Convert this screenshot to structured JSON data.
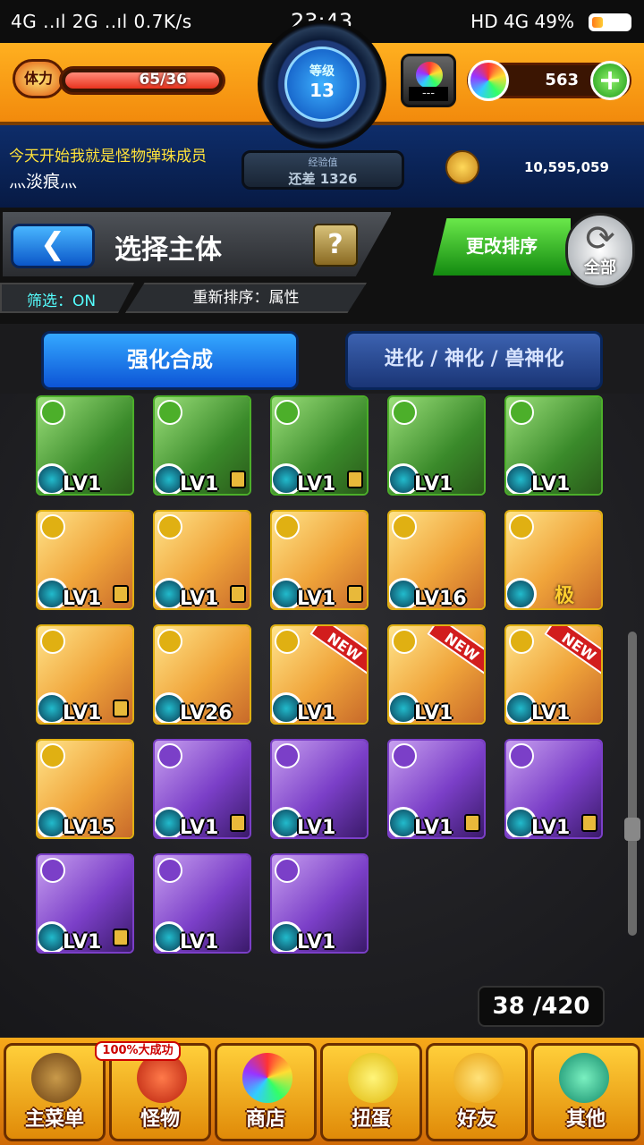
{
  "status_bar": {
    "network": "4G ..ıl 2G ..ıl 0.7K/s",
    "time": "23:43",
    "right": "HD 4G 49%"
  },
  "player": {
    "stamina_label": "体力",
    "stamina_value": "65/36",
    "stamina_fraction": 1.0,
    "level_label": "等级",
    "level": "13",
    "exp_label": "经验值",
    "exp_remaining": "还差 1326",
    "hatch_label": "---",
    "orbs": "563",
    "motto": "今天开始我就是怪物弹珠成员",
    "name": "灬淡痕灬",
    "gold": "10,595,059"
  },
  "header": {
    "title": "选择主体",
    "help": "?",
    "filter": "筛选：ON",
    "sort": "重新排序：属性",
    "change_sort": "更改排序",
    "all": "全部"
  },
  "tabs": [
    "强化合成",
    "进化 / 神化 / 兽神化"
  ],
  "colors": {
    "accent_orange": "#f28a0c",
    "wood": "#4caf2a",
    "light": "#e0b012",
    "dark": "#7b3fc8"
  },
  "monsters": [
    {
      "level": "LV1",
      "element": "wood",
      "locked": false,
      "new": false
    },
    {
      "level": "LV1",
      "element": "wood",
      "locked": true,
      "new": false
    },
    {
      "level": "LV1",
      "element": "wood",
      "locked": true,
      "new": false
    },
    {
      "level": "LV1",
      "element": "wood",
      "locked": false,
      "new": false
    },
    {
      "level": "LV1",
      "element": "wood",
      "locked": false,
      "new": false
    },
    {
      "level": "LV1",
      "element": "light",
      "locked": true,
      "new": false
    },
    {
      "level": "LV1",
      "element": "light",
      "locked": true,
      "new": false
    },
    {
      "level": "LV1",
      "element": "light",
      "locked": true,
      "new": false
    },
    {
      "level": "LV16",
      "element": "light",
      "locked": false,
      "new": false
    },
    {
      "level": "",
      "element": "light",
      "locked": false,
      "new": false,
      "badge": "极"
    },
    {
      "level": "LV1",
      "element": "light",
      "locked": true,
      "new": false
    },
    {
      "level": "LV26",
      "element": "light",
      "locked": false,
      "new": false
    },
    {
      "level": "LV1",
      "element": "light",
      "locked": false,
      "new": true
    },
    {
      "level": "LV1",
      "element": "light",
      "locked": false,
      "new": true
    },
    {
      "level": "LV1",
      "element": "light",
      "locked": false,
      "new": true
    },
    {
      "level": "LV15",
      "element": "light",
      "locked": false,
      "new": false
    },
    {
      "level": "LV1",
      "element": "dark",
      "locked": true,
      "new": false
    },
    {
      "level": "LV1",
      "element": "dark",
      "locked": false,
      "new": false
    },
    {
      "level": "LV1",
      "element": "dark",
      "locked": true,
      "new": false
    },
    {
      "level": "LV1",
      "element": "dark",
      "locked": true,
      "new": false
    },
    {
      "level": "LV1",
      "element": "dark",
      "locked": true,
      "new": false
    },
    {
      "level": "LV1",
      "element": "dark",
      "locked": false,
      "new": false
    },
    {
      "level": "LV1",
      "element": "dark",
      "locked": false,
      "new": false
    }
  ],
  "new_badge": "NEW",
  "box_count": "38 /420",
  "nav": {
    "promo": "100%大成功",
    "items": [
      "主菜单",
      "怪物",
      "商店",
      "扭蛋",
      "好友",
      "其他"
    ]
  }
}
